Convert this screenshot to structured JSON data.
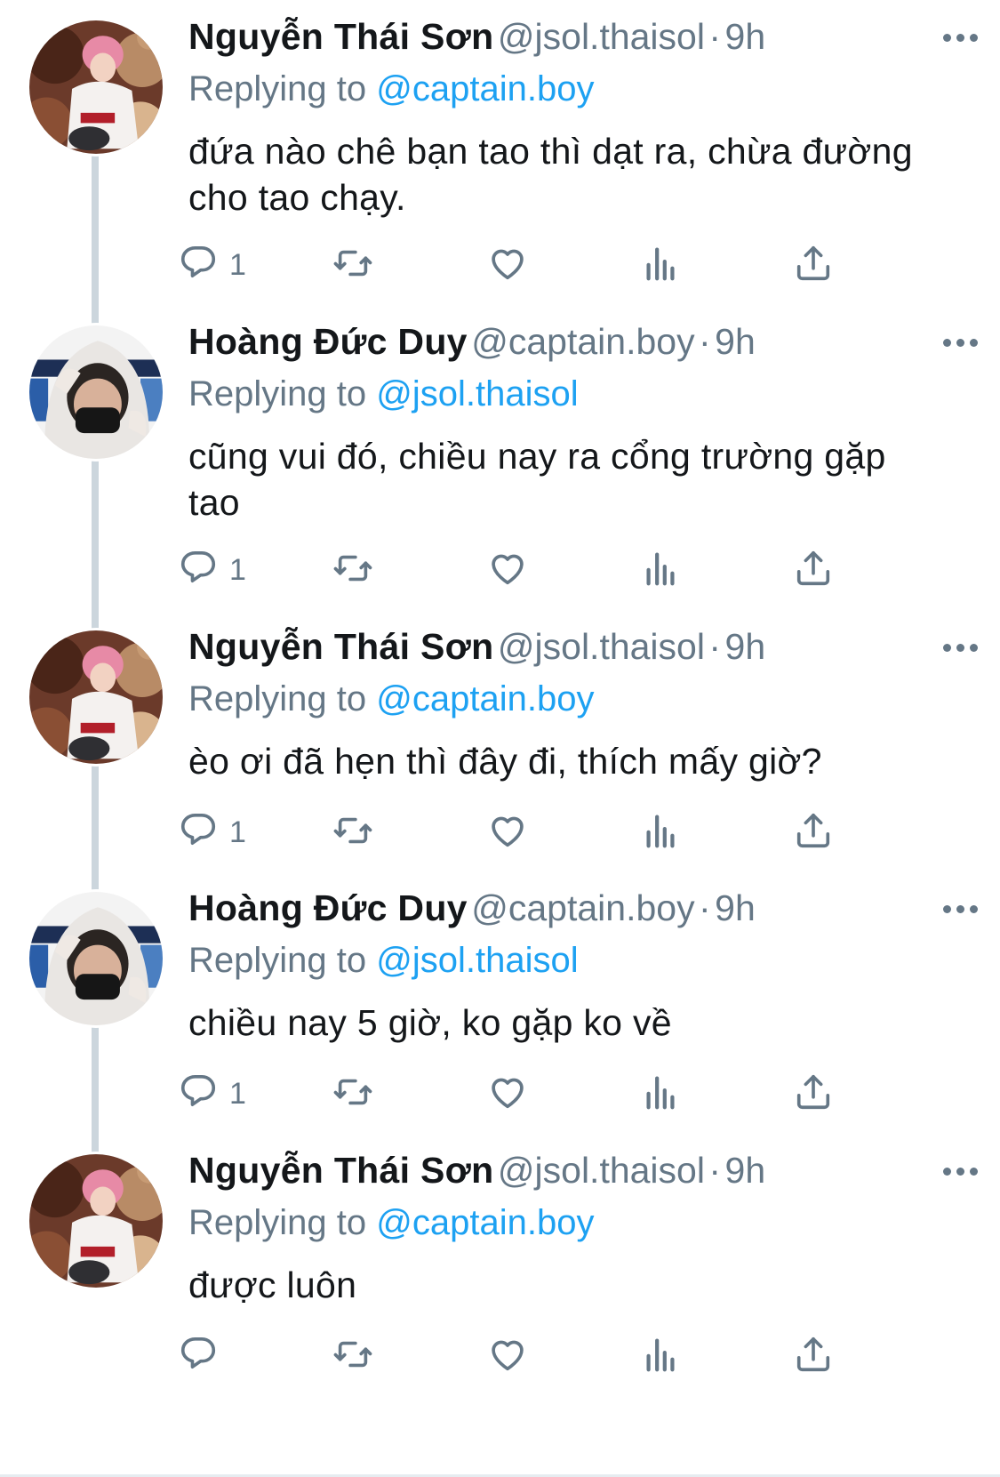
{
  "thread": {
    "tweets": [
      {
        "author_name": "Nguyễn Thái Sơn",
        "handle": "@jsol.thaisol",
        "separator": "·",
        "time": "9h",
        "replying_prefix": "Replying to",
        "replying_handle": "@captain.boy",
        "text_lines": [
          "đứa nào chê bạn tao thì dạt ra, chừa đường",
          "cho tao chạy."
        ],
        "reply_count": "1",
        "avatar": "avatar-pink-hair"
      },
      {
        "author_name": "Hoàng Đức Duy",
        "handle": "@captain.boy",
        "separator": "·",
        "time": "9h",
        "replying_prefix": "Replying to",
        "replying_handle": "@jsol.thaisol",
        "text_lines": [
          "cũng vui đó, chiều nay ra cổng trường gặp",
          "tao"
        ],
        "reply_count": "1",
        "avatar": "avatar-white-hood"
      },
      {
        "author_name": "Nguyễn Thái Sơn",
        "handle": "@jsol.thaisol",
        "separator": "·",
        "time": "9h",
        "replying_prefix": "Replying to",
        "replying_handle": "@captain.boy",
        "text_lines": [
          "èo ơi đã hẹn thì đây đi, thích mấy giờ?"
        ],
        "reply_count": "1",
        "avatar": "avatar-pink-hair"
      },
      {
        "author_name": "Hoàng Đức Duy",
        "handle": "@captain.boy",
        "separator": "·",
        "time": "9h",
        "replying_prefix": "Replying to",
        "replying_handle": "@jsol.thaisol",
        "text_lines": [
          "chiều nay 5 giờ, ko gặp ko về"
        ],
        "reply_count": "1",
        "avatar": "avatar-white-hood"
      },
      {
        "author_name": "Nguyễn Thái Sơn",
        "handle": "@jsol.thaisol",
        "separator": "·",
        "time": "9h",
        "replying_prefix": "Replying to",
        "replying_handle": "@captain.boy",
        "text_lines": [
          "được luôn"
        ],
        "reply_count": "",
        "avatar": "avatar-pink-hair"
      }
    ]
  },
  "icons": {
    "reply": "reply-icon",
    "retweet": "retweet-icon",
    "like": "heart-icon",
    "analytics": "analytics-icon",
    "share": "share-icon",
    "more": "more-icon"
  },
  "colors": {
    "name": "#14171a",
    "meta": "#657786",
    "link": "#1da1f2",
    "thread_line": "#ccd6dd"
  }
}
